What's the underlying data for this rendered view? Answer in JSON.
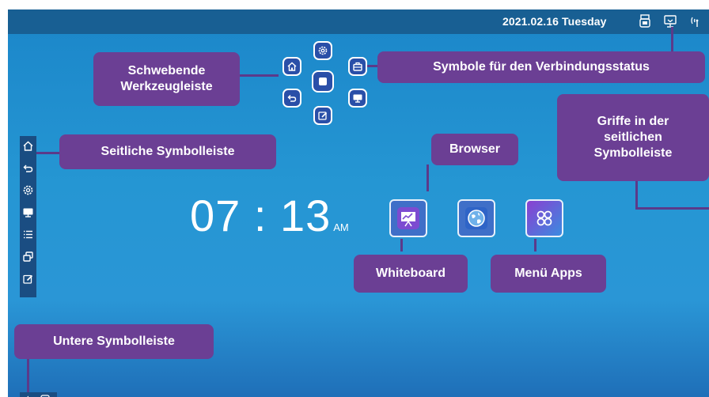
{
  "status_bar": {
    "datetime": "2021.02.16 Tuesday",
    "icons": [
      "usb-icon",
      "screen-share-icon",
      "wifi-antenna-icon"
    ]
  },
  "clock": {
    "time": "07 : 13",
    "ampm": "AM"
  },
  "floating_toolbar": {
    "buttons": [
      "gear-icon",
      "home-icon",
      "toolbox-icon",
      "stop-icon",
      "back-icon",
      "monitor-icon",
      "edit-icon"
    ]
  },
  "side_toolbar": {
    "icons": [
      "home-icon",
      "back-icon",
      "gear-icon",
      "monitor-icon",
      "list-icon",
      "windows-icon",
      "edit-icon"
    ]
  },
  "apps": [
    "whiteboard-icon",
    "browser-icon",
    "apps-menu-icon"
  ],
  "bottom_toolbar": {
    "icons": [
      "volume-icon",
      "record-icon"
    ]
  },
  "callouts": {
    "floating_toolbar": "Schwebende Werkzeugleiste",
    "status_icons": "Symbole für den Verbindungsstatus",
    "side_toolbar": "Seitliche Symbolleiste",
    "side_handles": "Griffe in der seitlichen Symbolleiste",
    "browser": "Browser",
    "whiteboard": "Whiteboard",
    "menu_apps": "Menü Apps",
    "bottom_toolbar": "Untere Symbolleiste"
  },
  "colors": {
    "callout_bg": "#6b3f94",
    "top_bar": "#185f93",
    "desktop": "#2596d3",
    "toolbar_button": "#2a4fa8"
  }
}
